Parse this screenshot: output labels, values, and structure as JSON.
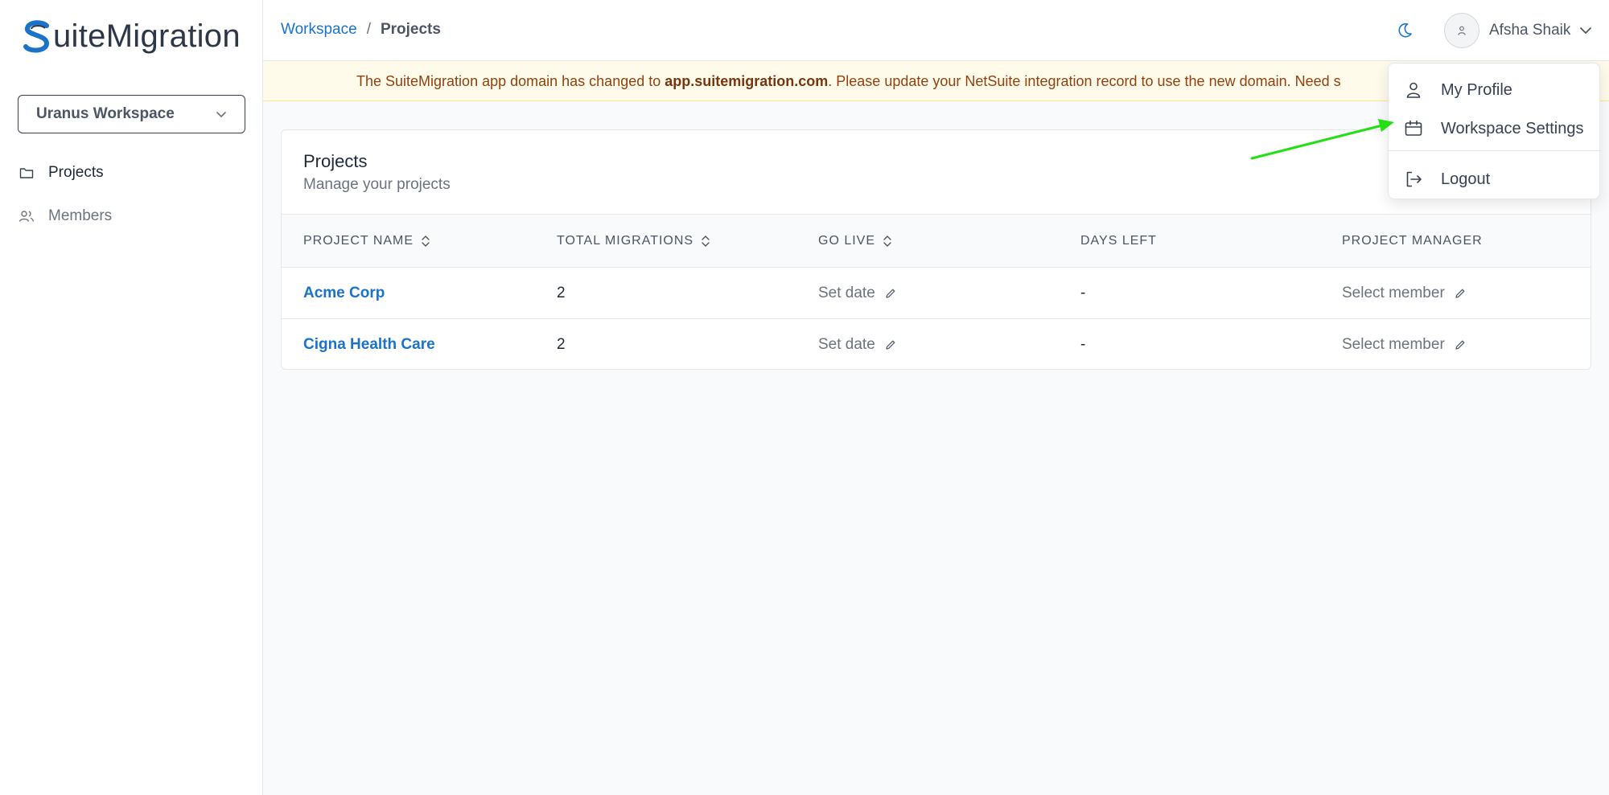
{
  "brand": {
    "logo_text": "uiteMigration"
  },
  "sidebar": {
    "workspace_select": "Uranus Workspace",
    "items": [
      {
        "label": "Projects",
        "icon": "folder-icon",
        "active": true
      },
      {
        "label": "Members",
        "icon": "users-icon",
        "active": false
      }
    ]
  },
  "header": {
    "breadcrumb": {
      "root": "Workspace",
      "separator": "/",
      "current": "Projects"
    },
    "user_name": "Afsha Shaik"
  },
  "banner": {
    "prefix": "The SuiteMigration app domain has changed to ",
    "domain": "app.suitemigration.com",
    "suffix": ". Please update your NetSuite integration record to use the new domain. Need s"
  },
  "card": {
    "title": "Projects",
    "subtitle": "Manage your projects",
    "columns": [
      "PROJECT NAME",
      "TOTAL MIGRATIONS",
      "GO LIVE",
      "DAYS LEFT",
      "PROJECT MANAGER"
    ],
    "rows": [
      {
        "name": "Acme Corp",
        "migrations": "2",
        "go_live": "Set date",
        "days_left": "-",
        "manager": "Select member"
      },
      {
        "name": "Cigna Health Care",
        "migrations": "2",
        "go_live": "Set date",
        "days_left": "-",
        "manager": "Select member"
      }
    ]
  },
  "dropdown": {
    "items": [
      {
        "label": "My Profile",
        "icon": "user-icon"
      },
      {
        "label": "Workspace Settings",
        "icon": "settings-calendar-icon"
      },
      {
        "label": "Logout",
        "icon": "logout-icon"
      }
    ]
  },
  "colors": {
    "accent": "#1a73c8",
    "banner_bg": "#fffbeb",
    "banner_text": "#92400e",
    "annotation_arrow": "#22e012"
  }
}
